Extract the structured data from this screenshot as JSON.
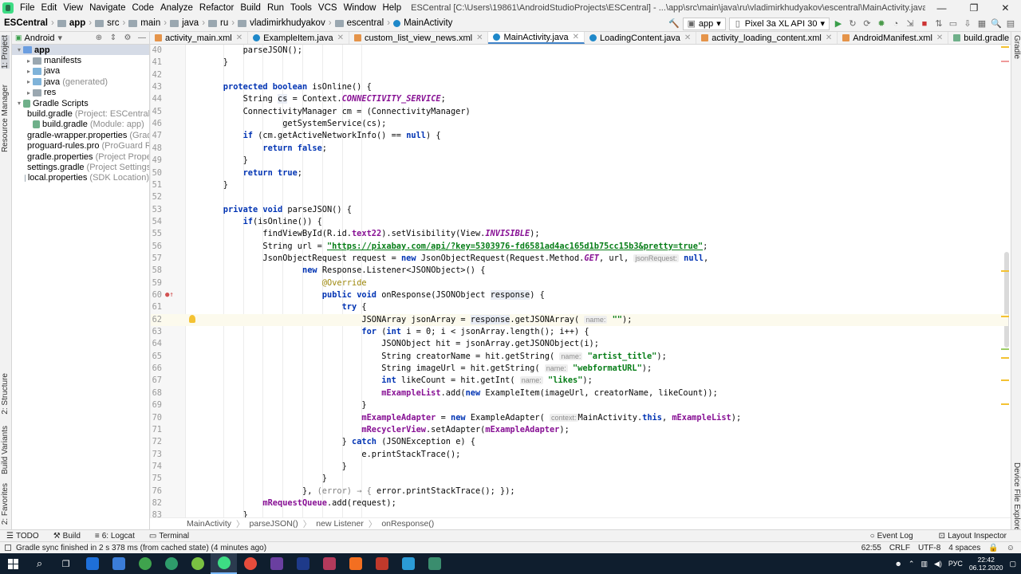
{
  "menubar": {
    "items": [
      "File",
      "Edit",
      "View",
      "Navigate",
      "Code",
      "Analyze",
      "Refactor",
      "Build",
      "Run",
      "Tools",
      "VCS",
      "Window",
      "Help"
    ],
    "window_title": "ESCentral [C:\\Users\\19861\\AndroidStudioProjects\\ESCentral] - ...\\app\\src\\main\\java\\ru\\vladimirkhudyakov\\escentral\\MainActivity.java [app] - Android Studio",
    "minimize": "—",
    "maximize": "❐",
    "close": "✕"
  },
  "navbar": {
    "crumbs": [
      "ESCentral",
      "app",
      "src",
      "main",
      "java",
      "ru",
      "vladimirkhudyakov",
      "escentral",
      "MainActivity"
    ],
    "run_config": "app",
    "device": "Pixel 3a XL API 30"
  },
  "left_tabs": {
    "project": "1: Project",
    "resource_manager": "Resource Manager",
    "structure": "2: Structure",
    "build_variants": "Build Variants",
    "favorites": "2: Favorites"
  },
  "right_tabs": {
    "gradle": "Gradle",
    "device_file_explorer": "Device File Explorer"
  },
  "project_panel": {
    "view_mode": "Android",
    "tree": [
      {
        "label": "app",
        "note": "",
        "level": 0,
        "icon": "app",
        "arrow": "▾",
        "selected": true
      },
      {
        "label": "manifests",
        "note": "",
        "level": 1,
        "icon": "folder",
        "arrow": "▸",
        "selected": false
      },
      {
        "label": "java",
        "note": "",
        "level": 1,
        "icon": "src",
        "arrow": "▸",
        "selected": false
      },
      {
        "label": "java",
        "note": "(generated)",
        "level": 1,
        "icon": "src",
        "arrow": "▸",
        "selected": false
      },
      {
        "label": "res",
        "note": "",
        "level": 1,
        "icon": "folder",
        "arrow": "▸",
        "selected": false
      },
      {
        "label": "Gradle Scripts",
        "note": "",
        "level": 0,
        "icon": "gradle",
        "arrow": "▾",
        "selected": false
      },
      {
        "label": "build.gradle",
        "note": "(Project: ESCentral)",
        "level": 1,
        "icon": "gradle",
        "arrow": "",
        "selected": false
      },
      {
        "label": "build.gradle",
        "note": "(Module: app)",
        "level": 1,
        "icon": "gradle",
        "arrow": "",
        "selected": false
      },
      {
        "label": "gradle-wrapper.properties",
        "note": "(Gradle",
        "level": 1,
        "icon": "folder",
        "arrow": "",
        "selected": false
      },
      {
        "label": "proguard-rules.pro",
        "note": "(ProGuard Rul",
        "level": 1,
        "icon": "folder",
        "arrow": "",
        "selected": false
      },
      {
        "label": "gradle.properties",
        "note": "(Project Properti",
        "level": 1,
        "icon": "folder",
        "arrow": "",
        "selected": false
      },
      {
        "label": "settings.gradle",
        "note": "(Project Settings)",
        "level": 1,
        "icon": "gradle",
        "arrow": "",
        "selected": false
      },
      {
        "label": "local.properties",
        "note": "(SDK Location)",
        "level": 1,
        "icon": "folder",
        "arrow": "",
        "selected": false
      }
    ]
  },
  "editor_tabs": [
    {
      "label": "activity_main.xml",
      "type": "xml",
      "active": false
    },
    {
      "label": "ExampleItem.java",
      "type": "class",
      "active": false
    },
    {
      "label": "custom_list_view_news.xml",
      "type": "xml",
      "active": false
    },
    {
      "label": "MainActivity.java",
      "type": "class",
      "active": true
    },
    {
      "label": "LoadingContent.java",
      "type": "class",
      "active": false
    },
    {
      "label": "activity_loading_content.xml",
      "type": "xml",
      "active": false
    },
    {
      "label": "AndroidManifest.xml",
      "type": "xml",
      "active": false
    },
    {
      "label": "build.gradle (:app)",
      "type": "gradle",
      "active": false
    }
  ],
  "code_lines": [
    {
      "n": "40",
      "ind": 2,
      "s": [
        [
          "",
          "parseJSON();"
        ]
      ]
    },
    {
      "n": "41",
      "ind": 1,
      "s": [
        [
          "",
          "}"
        ]
      ]
    },
    {
      "n": "42",
      "ind": 0,
      "s": []
    },
    {
      "n": "43",
      "ind": 1,
      "s": [
        [
          "kw",
          "protected boolean "
        ],
        [
          "",
          "isOnline() {"
        ]
      ]
    },
    {
      "n": "44",
      "ind": 2,
      "s": [
        [
          "",
          "String "
        ],
        [
          "hl",
          "cs"
        ],
        [
          "",
          " = Context."
        ],
        [
          "cst",
          "CONNECTIVITY_SERVICE"
        ],
        [
          "",
          ";"
        ]
      ]
    },
    {
      "n": "45",
      "ind": 2,
      "s": [
        [
          "",
          "ConnectivityManager cm = (ConnectivityManager)"
        ]
      ]
    },
    {
      "n": "46",
      "ind": 4,
      "s": [
        [
          "",
          "getSystemService(cs);"
        ]
      ]
    },
    {
      "n": "47",
      "ind": 2,
      "s": [
        [
          "kw",
          "if "
        ],
        [
          "",
          "(cm.getActiveNetworkInfo() == "
        ],
        [
          "kw",
          "null"
        ],
        [
          "",
          ") {"
        ]
      ]
    },
    {
      "n": "48",
      "ind": 3,
      "s": [
        [
          "kw",
          "return false"
        ],
        [
          "",
          ";"
        ]
      ]
    },
    {
      "n": "49",
      "ind": 2,
      "s": [
        [
          "",
          "}"
        ]
      ]
    },
    {
      "n": "50",
      "ind": 2,
      "s": [
        [
          "kw",
          "return true"
        ],
        [
          "",
          ";"
        ]
      ]
    },
    {
      "n": "51",
      "ind": 1,
      "s": [
        [
          "",
          "}"
        ]
      ]
    },
    {
      "n": "52",
      "ind": 0,
      "s": []
    },
    {
      "n": "53",
      "ind": 1,
      "s": [
        [
          "kw",
          "private void "
        ],
        [
          "",
          "parseJSON() {"
        ]
      ]
    },
    {
      "n": "54",
      "ind": 2,
      "s": [
        [
          "kw",
          "if"
        ],
        [
          "",
          "(isOnline()) {"
        ]
      ]
    },
    {
      "n": "55",
      "ind": 3,
      "s": [
        [
          "",
          "findViewById(R.id."
        ],
        [
          "fld",
          "text22"
        ],
        [
          "",
          ").setVisibility(View."
        ],
        [
          "cst",
          "INVISIBLE"
        ],
        [
          "",
          ");"
        ]
      ]
    },
    {
      "n": "56",
      "ind": 3,
      "s": [
        [
          "",
          "String url = "
        ],
        [
          "url",
          "\"https://pixabay.com/api/?key=5303976-fd6581ad4ac165d1b75cc15b3&pretty=true\""
        ],
        [
          "",
          ";"
        ]
      ]
    },
    {
      "n": "57",
      "ind": 3,
      "s": [
        [
          "",
          "JsonObjectRequest request = "
        ],
        [
          "kw",
          "new "
        ],
        [
          "",
          "JsonObjectRequest(Request.Method."
        ],
        [
          "cst",
          "GET"
        ],
        [
          "",
          ", url, "
        ],
        [
          "hint",
          "jsonRequest:"
        ],
        [
          "",
          " "
        ],
        [
          "kw",
          "null"
        ],
        [
          "",
          ","
        ]
      ]
    },
    {
      "n": "58",
      "ind": 5,
      "s": [
        [
          "kw",
          "new "
        ],
        [
          "",
          "Response.Listener<JSONObject>() {"
        ]
      ]
    },
    {
      "n": "59",
      "ind": 6,
      "s": [
        [
          "ann",
          "@Override"
        ]
      ]
    },
    {
      "n": "60",
      "ind": 6,
      "s": [
        [
          "kw",
          "public void "
        ],
        [
          "",
          "onResponse(JSONObject "
        ],
        [
          "hl",
          "response"
        ],
        [
          "",
          ") {"
        ]
      ],
      "mark": "override"
    },
    {
      "n": "61",
      "ind": 7,
      "s": [
        [
          "kw",
          "try "
        ],
        [
          "",
          "{"
        ]
      ]
    },
    {
      "n": "62",
      "ind": 8,
      "s": [
        [
          "",
          "JSONArray jsonArray = "
        ],
        [
          "hl",
          "response"
        ],
        [
          "",
          ".getJSONArray( "
        ],
        [
          "hint",
          "name:"
        ],
        [
          "",
          " "
        ],
        [
          "str",
          "\"\""
        ],
        [
          "",
          ");"
        ]
      ],
      "current": true,
      "bulb": true
    },
    {
      "n": "63",
      "ind": 8,
      "s": [
        [
          "kw",
          "for "
        ],
        [
          "",
          "("
        ],
        [
          "kw",
          "int "
        ],
        [
          "",
          "i = "
        ],
        [
          "",
          "0"
        ],
        [
          "",
          "; i < jsonArray.length(); i++) {"
        ]
      ]
    },
    {
      "n": "64",
      "ind": 9,
      "s": [
        [
          "",
          "JSONObject hit = jsonArray.getJSONObject(i);"
        ]
      ]
    },
    {
      "n": "65",
      "ind": 9,
      "s": [
        [
          "",
          "String creatorName = hit.getString( "
        ],
        [
          "hint",
          "name:"
        ],
        [
          "",
          " "
        ],
        [
          "str",
          "\"artist_title\""
        ],
        [
          "",
          ");"
        ]
      ]
    },
    {
      "n": "66",
      "ind": 9,
      "s": [
        [
          "",
          "String imageUrl = hit.getString( "
        ],
        [
          "hint",
          "name:"
        ],
        [
          "",
          " "
        ],
        [
          "str",
          "\"webformatURL\""
        ],
        [
          "",
          ");"
        ]
      ]
    },
    {
      "n": "67",
      "ind": 9,
      "s": [
        [
          "kw",
          "int "
        ],
        [
          "",
          "likeCount = hit.getInt( "
        ],
        [
          "hint",
          "name:"
        ],
        [
          "",
          " "
        ],
        [
          "str",
          "\"likes\""
        ],
        [
          "",
          ");"
        ]
      ]
    },
    {
      "n": "68",
      "ind": 9,
      "s": [
        [
          "fld",
          "mExampleList"
        ],
        [
          "",
          ".add("
        ],
        [
          "kw",
          "new "
        ],
        [
          "",
          "ExampleItem(imageUrl, creatorName, likeCount));"
        ]
      ]
    },
    {
      "n": "69",
      "ind": 8,
      "s": [
        [
          "",
          "}"
        ]
      ]
    },
    {
      "n": "70",
      "ind": 8,
      "s": [
        [
          "fld",
          "mExampleAdapter"
        ],
        [
          "",
          " = "
        ],
        [
          "kw",
          "new "
        ],
        [
          "",
          "ExampleAdapter( "
        ],
        [
          "hint",
          "context:"
        ],
        [
          "",
          "MainActivity."
        ],
        [
          "kw",
          "this"
        ],
        [
          "",
          ", "
        ],
        [
          "fld",
          "mExampleList"
        ],
        [
          "",
          ");"
        ]
      ]
    },
    {
      "n": "71",
      "ind": 8,
      "s": [
        [
          "fld",
          "mRecyclerView"
        ],
        [
          "",
          ".setAdapter("
        ],
        [
          "fld",
          "mExampleAdapter"
        ],
        [
          "",
          ");"
        ]
      ]
    },
    {
      "n": "72",
      "ind": 7,
      "s": [
        [
          "",
          "} "
        ],
        [
          "kw",
          "catch "
        ],
        [
          "",
          "(JSONException e) {"
        ]
      ]
    },
    {
      "n": "73",
      "ind": 8,
      "s": [
        [
          "",
          "e.printStackTrace();"
        ]
      ]
    },
    {
      "n": "74",
      "ind": 7,
      "s": [
        [
          "",
          "}"
        ]
      ]
    },
    {
      "n": "75",
      "ind": 6,
      "s": [
        [
          "",
          "}"
        ]
      ]
    },
    {
      "n": "76",
      "ind": 5,
      "s": [
        [
          "",
          "}, "
        ],
        [
          "lam",
          "(error) → { "
        ],
        [
          "",
          "error.printStackTrace(); });"
        ]
      ]
    },
    {
      "n": "82",
      "ind": 3,
      "s": [
        [
          "fld",
          "mRequestQueue"
        ],
        [
          "",
          ".add(request);"
        ]
      ]
    },
    {
      "n": "83",
      "ind": 2,
      "s": [
        [
          "",
          "}"
        ]
      ]
    }
  ],
  "editor_breadcrumb": [
    "MainActivity",
    "parseJSON()",
    "new Listener",
    "onResponse()"
  ],
  "bottom_tabs": {
    "todo": "TODO",
    "build": "Build",
    "logcat": "6: Logcat",
    "terminal": "Terminal",
    "event_log": "Event Log",
    "layout_inspector": "Layout Inspector"
  },
  "status": {
    "message": "Gradle sync finished in 2 s 378 ms (from cached state) (4 minutes ago)",
    "position": "62:55",
    "line_sep": "CRLF",
    "encoding": "UTF-8",
    "indent": "4 spaces"
  },
  "taskbar": {
    "apps": [
      "#1e6fd9",
      "#3b7dd8",
      "#3fa34d",
      "#2e9c6b",
      "#7ac142",
      "#3ddc84",
      "#e74c3c",
      "#6a3fa0",
      "#1e3a8a",
      "#b33a5c",
      "#f36f21",
      "#c0392b",
      "#2b9bd6",
      "#3a8d6e"
    ],
    "active_index": 5,
    "lang": "РУС",
    "time": "22:42",
    "date": "06.12.2020"
  }
}
